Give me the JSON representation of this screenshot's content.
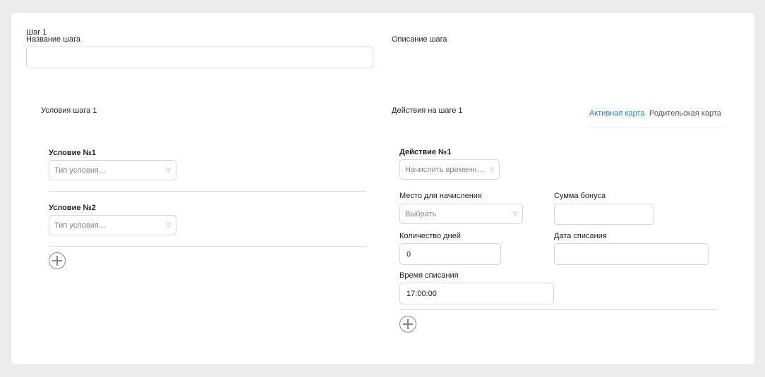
{
  "step": {
    "title": "Шаг 1",
    "name_label": "Название шага",
    "name_value": "",
    "description_label": "Описание шага"
  },
  "conditions": {
    "title": "Условия шага 1",
    "items": [
      {
        "label": "Условие №1",
        "placeholder": "Тип условия..."
      },
      {
        "label": "Условие №2",
        "placeholder": "Тип условия..."
      }
    ]
  },
  "actions": {
    "title": "Действия на шаге 1",
    "tabs": [
      {
        "label": "Активная карта",
        "active": true
      },
      {
        "label": "Родительская карта",
        "active": false
      }
    ],
    "action1": {
      "label": "Действие №1",
      "type_value": "Начислить временны...",
      "place_label": "Место для начисления",
      "place_value": "Выбрать",
      "bonus_label": "Сумма бонуса",
      "bonus_value": "",
      "days_label": "Количество дней",
      "days_value": "0",
      "date_label": "Дата списания",
      "date_value": "",
      "time_label": "Время списания",
      "time_value": "17:00:00"
    }
  },
  "colors": {
    "accent": "#1a82d8",
    "tab_inactive": "#555555"
  }
}
